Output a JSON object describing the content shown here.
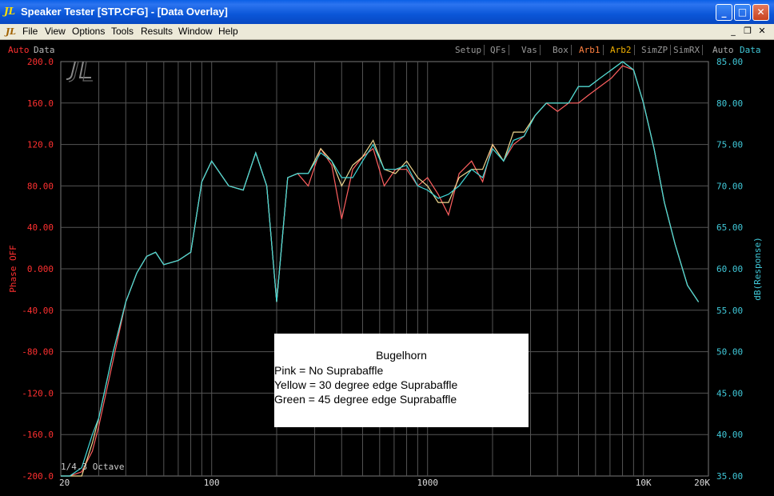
{
  "window": {
    "title": "Speaker Tester [STP.CFG] - [Data Overlay]",
    "app_icon_text": "JL",
    "min_glyph": "_",
    "max_glyph": "□",
    "close_glyph": "✕"
  },
  "menu": {
    "items": [
      "File",
      "View",
      "Options",
      "Tools",
      "Results",
      "Window",
      "Help"
    ],
    "mdi_min": "_",
    "mdi_restore": "❐",
    "mdi_close": "✕"
  },
  "toolbar": {
    "left": {
      "auto": "Auto",
      "data": "Data"
    },
    "buttons": [
      "Setup",
      "QFs",
      "Vas",
      "Box",
      "Arb1",
      "Arb2",
      "SimZP",
      "SimRX"
    ],
    "right": {
      "auto": "Auto",
      "data": "Data"
    }
  },
  "colors": {
    "left_axis": "#ff3030",
    "right_axis": "#40c8d8",
    "grid": "#555555",
    "pink": "#ff6060",
    "yellow": "#f0d890",
    "green": "#40d8d8",
    "arb_orange": "#ff8040"
  },
  "status": {
    "octave": "1/4.3 Octave"
  },
  "legend": {
    "title": "Bugelhorn",
    "lines": [
      "Pink = No Suprabaffle",
      "Yellow = 30 degree edge Suprabaffle",
      "Green = 45 degree edge Suprabaffle"
    ]
  },
  "chart_data": {
    "type": "line",
    "x_scale": "log",
    "xlim": [
      20,
      20000
    ],
    "x_tick_labels": [
      {
        "value": 20,
        "label": "20"
      },
      {
        "value": 100,
        "label": "100"
      },
      {
        "value": 1000,
        "label": "1000"
      },
      {
        "value": 10000,
        "label": "10K"
      },
      {
        "value": 20000,
        "label": "20K"
      }
    ],
    "y_left": {
      "label": "Phase OFF",
      "range": [
        -200,
        200
      ],
      "ticks": [
        "200.0",
        "160.0",
        "120.0",
        "80.00",
        "40.00",
        "0.000",
        "-40.00",
        "-80.00",
        "-120.0",
        "-160.0",
        "-200.0"
      ]
    },
    "y_right": {
      "label": "dB(Response)",
      "range": [
        35,
        85
      ],
      "ticks": [
        "85.00",
        "80.00",
        "75.00",
        "70.00",
        "65.00",
        "60.00",
        "55.00",
        "50.00",
        "45.00",
        "40.00",
        "35.00"
      ]
    },
    "x": [
      20,
      22,
      25,
      28,
      30,
      35,
      40,
      45,
      50,
      55,
      60,
      70,
      80,
      90,
      100,
      120,
      140,
      160,
      180,
      200,
      225,
      250,
      280,
      320,
      360,
      400,
      450,
      500,
      560,
      630,
      710,
      800,
      900,
      1000,
      1120,
      1250,
      1400,
      1600,
      1800,
      2000,
      2250,
      2500,
      2800,
      3150,
      3550,
      4000,
      4500,
      5000,
      5600,
      6300,
      7100,
      8000,
      9000,
      10000,
      11200,
      12500,
      14000,
      16000,
      18000
    ],
    "series": [
      {
        "name": "Pink",
        "color": "#ff6060",
        "values": [
          35,
          35,
          35.5,
          38,
          41,
          49,
          56,
          59.5,
          61.5,
          62,
          60.5,
          61,
          62,
          70.5,
          73,
          70,
          69.5,
          74,
          70,
          56,
          71,
          71.5,
          70,
          74.5,
          72.5,
          66,
          72,
          73.5,
          74.5,
          70,
          72,
          72,
          70,
          71,
          69,
          66.5,
          71.5,
          73,
          70.5,
          75,
          73,
          75,
          76,
          78.5,
          80,
          79,
          80,
          80,
          81,
          82,
          83,
          84.5,
          84,
          80,
          74.5,
          68,
          63,
          58,
          56
        ]
      },
      {
        "name": "Yellow",
        "color": "#f0d890",
        "values": [
          35,
          35,
          35,
          39,
          42,
          50,
          56,
          59.5,
          61.5,
          62,
          60.5,
          61,
          62,
          70.5,
          73,
          70,
          69.5,
          74,
          70,
          56,
          71,
          71.5,
          71.5,
          74.5,
          73,
          70,
          72.5,
          73.5,
          75.5,
          72,
          71.5,
          73,
          71,
          70,
          68,
          68,
          71,
          72,
          72,
          75,
          73,
          76.5,
          76.5,
          78.5,
          80,
          80,
          80,
          82,
          82,
          83,
          84,
          85,
          84,
          80,
          74.5,
          68,
          63,
          58,
          56
        ]
      },
      {
        "name": "Green",
        "color": "#40d8d8",
        "values": [
          35,
          35,
          36,
          40,
          42,
          50,
          56,
          59.5,
          61.5,
          62,
          60.5,
          61,
          62,
          70.5,
          73,
          70,
          69.5,
          74,
          70,
          56,
          71,
          71.5,
          71.5,
          74,
          73,
          71,
          71,
          73,
          75,
          72,
          72,
          72.5,
          70,
          69.5,
          68.5,
          69,
          70,
          72,
          71,
          74.5,
          73,
          75.5,
          76,
          78.5,
          80,
          80,
          80,
          82,
          82,
          83,
          84,
          85,
          84,
          80,
          74.5,
          68,
          63,
          58,
          56
        ]
      }
    ]
  }
}
